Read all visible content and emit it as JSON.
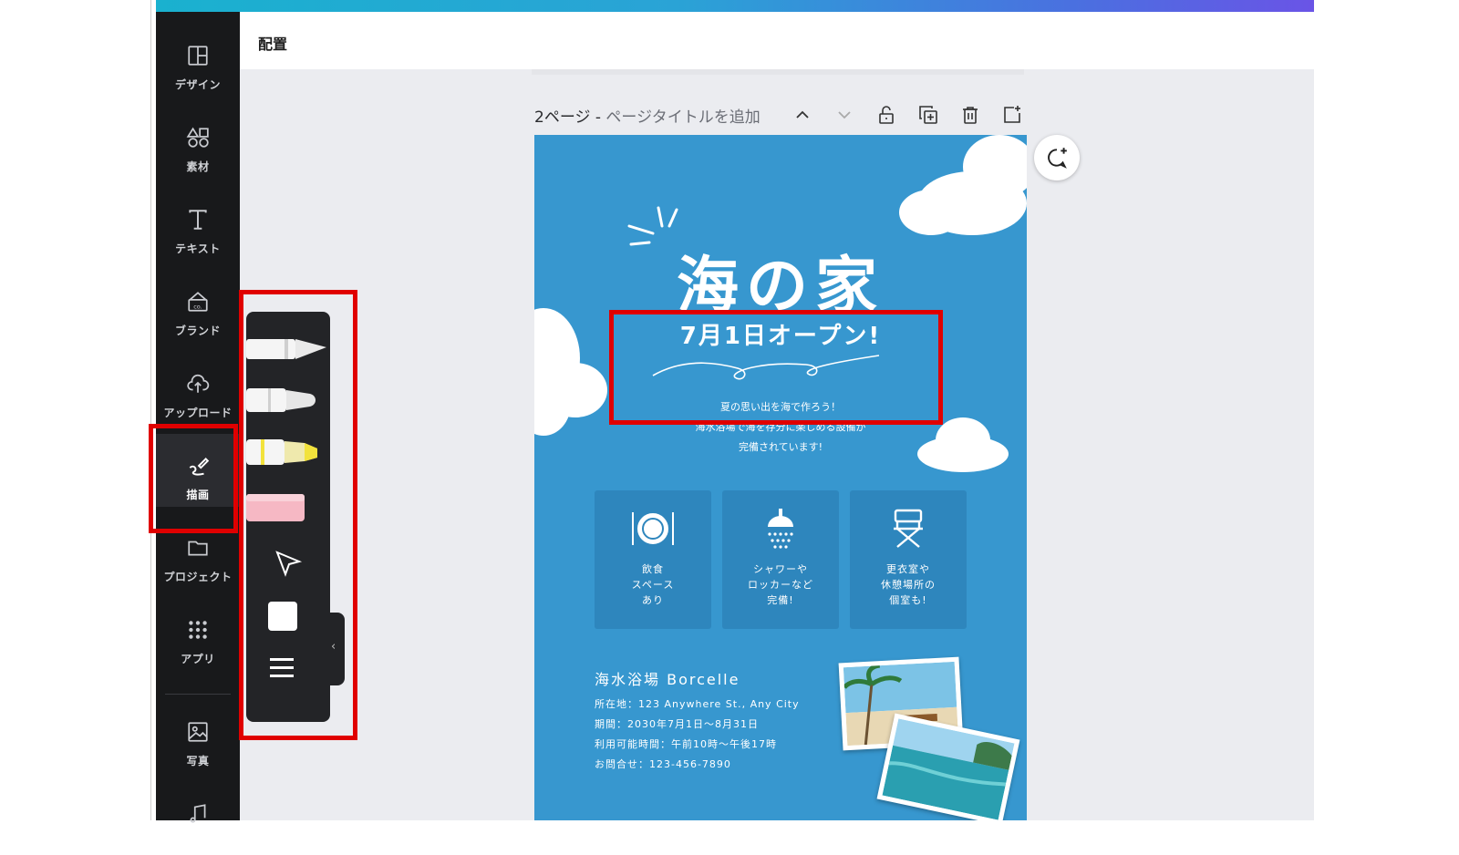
{
  "topbar": {
    "arrange_label": "配置"
  },
  "sidebar": {
    "items": [
      {
        "label": "デザイン",
        "icon": "layout-icon"
      },
      {
        "label": "素材",
        "icon": "shapes-icon"
      },
      {
        "label": "テキスト",
        "icon": "text-icon"
      },
      {
        "label": "ブランド",
        "icon": "brand-icon"
      },
      {
        "label": "アップロード",
        "icon": "cloud-upload-icon"
      },
      {
        "label": "描画",
        "icon": "draw-icon",
        "active": true
      },
      {
        "label": "プロジェクト",
        "icon": "folder-icon"
      },
      {
        "label": "アプリ",
        "icon": "apps-grid-icon"
      },
      {
        "label": "写真",
        "icon": "photo-icon"
      }
    ]
  },
  "page_header": {
    "page_label": "2ページ - ",
    "title_placeholder": "ページタイトルを追加"
  },
  "draw_panel": {
    "tools": [
      "pen-icon",
      "marker-icon",
      "highlighter-icon",
      "eraser-icon",
      "select-arrow-icon"
    ],
    "color_swatch": "#ffffff"
  },
  "canvas": {
    "title": "海の家",
    "open_date": "7月1日オープン!",
    "desc_lines": [
      "夏の思い出を海で作ろう！",
      "海水浴場で海を存分に楽しめる設備が",
      "完備されています!"
    ],
    "cards": [
      {
        "text": "飲食\nスペース\nあり",
        "icon": "dining-icon"
      },
      {
        "text": "シャワーや\nロッカーなど\n完備!",
        "icon": "shower-icon"
      },
      {
        "text": "更衣室や\n休憩場所の\n個室も!",
        "icon": "chair-icon"
      }
    ],
    "beach_name": "海水浴場 Borcelle",
    "info_lines": [
      "所在地：123 Anywhere St., Any City",
      "期間：2030年7月1日～8月31日",
      "利用可能時間：午前10時～午後17時",
      "お問合せ：123-456-7890"
    ]
  },
  "colors": {
    "canvas_bg": "#3797cf",
    "card_bg": "#2e86bd",
    "highlight": "#e00000",
    "sidebar_bg": "#18191b"
  }
}
